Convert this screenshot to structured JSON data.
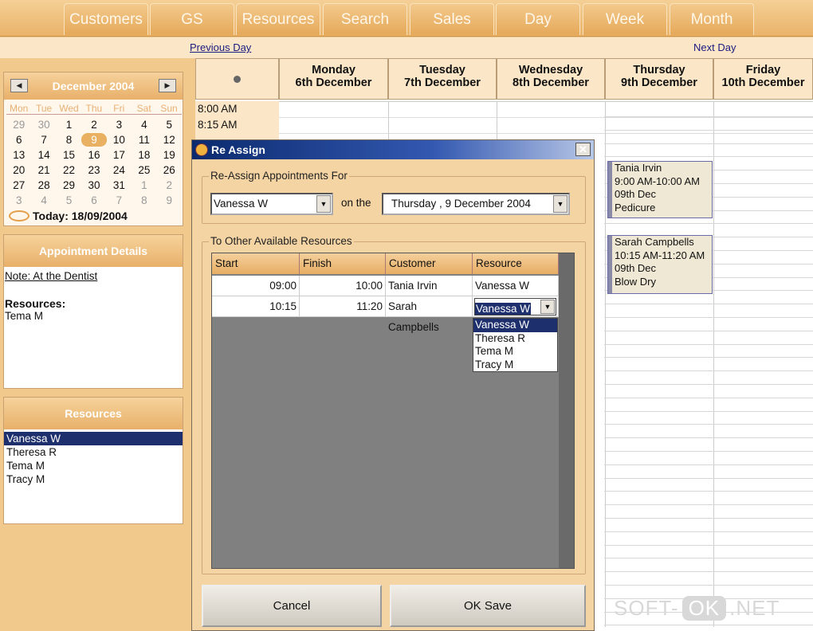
{
  "tabs": [
    "Customers",
    "GS",
    "Resources",
    "Search",
    "Sales",
    "Day",
    "Week",
    "Month"
  ],
  "nav": {
    "previous": "Previous Day",
    "next": "Next Day"
  },
  "calendar": {
    "month_label": "December 2004",
    "prev_icon": "left-arrow-icon",
    "next_icon": "right-arrow-icon",
    "weekdays": [
      "Mon",
      "Tue",
      "Wed",
      "Thu",
      "Fri",
      "Sat",
      "Sun"
    ],
    "days": [
      "29",
      "30",
      "1",
      "2",
      "3",
      "4",
      "5",
      "6",
      "7",
      "8",
      "9",
      "10",
      "11",
      "12",
      "13",
      "14",
      "15",
      "16",
      "17",
      "18",
      "19",
      "20",
      "21",
      "22",
      "23",
      "24",
      "25",
      "26",
      "27",
      "28",
      "29",
      "30",
      "31",
      "1",
      "2",
      "3",
      "4",
      "5",
      "6",
      "7",
      "8",
      "9"
    ],
    "selected_day": "9",
    "today_label": "Today: 18/09/2004"
  },
  "appointment_details": {
    "title": "Appointment Details",
    "note": "Note: At the Dentist",
    "resources_label": "Resources:",
    "resource": "Tema M"
  },
  "resources_panel": {
    "title": "Resources",
    "items": [
      "Vanessa W",
      "Theresa R",
      "Tema M",
      "Tracy M"
    ],
    "selected": "Vanessa W"
  },
  "schedule": {
    "day_headers": [
      {
        "day": "Monday",
        "date": "6th December"
      },
      {
        "day": "Tuesday",
        "date": "7th December"
      },
      {
        "day": "Wednesday",
        "date": "8th December"
      },
      {
        "day": "Thursday",
        "date": "9th December"
      },
      {
        "day": "Friday",
        "date": "10th December"
      }
    ],
    "times": [
      "8:00 AM",
      "8:15 AM"
    ],
    "appointments": [
      {
        "customer": "Tania Irvin",
        "time": "9:00 AM-10:00 AM",
        "date": "09th Dec",
        "service": "Pedicure"
      },
      {
        "customer": "Sarah Campbells",
        "time": "10:15 AM-11:20 AM",
        "date": "09th Dec",
        "service": "Blow Dry"
      }
    ]
  },
  "dialog": {
    "title": "Re Assign",
    "close_icon": "close-icon",
    "group1_label": "Re-Assign Appointments For",
    "resource_value": "Vanessa W",
    "on_the": "on the",
    "date_value": "Thursday ,  9  December 2004",
    "group2_label": "To Other Available Resources",
    "columns": [
      "Start",
      "Finish",
      "Customer",
      "Resource"
    ],
    "rows": [
      {
        "start": "09:00",
        "finish": "10:00",
        "customer": "Tania Irvin",
        "resource": "Vanessa W"
      },
      {
        "start": "10:15",
        "finish": "11:20",
        "customer": "Sarah Campbells",
        "resource": "Vanessa W"
      }
    ],
    "dropdown_options": [
      "Vanessa W",
      "Theresa R",
      "Tema M",
      "Tracy M"
    ],
    "cancel": "Cancel",
    "ok": "OK Save"
  },
  "watermark": {
    "left": "SOFT-",
    "mid": "OK",
    "right": ".NET"
  }
}
